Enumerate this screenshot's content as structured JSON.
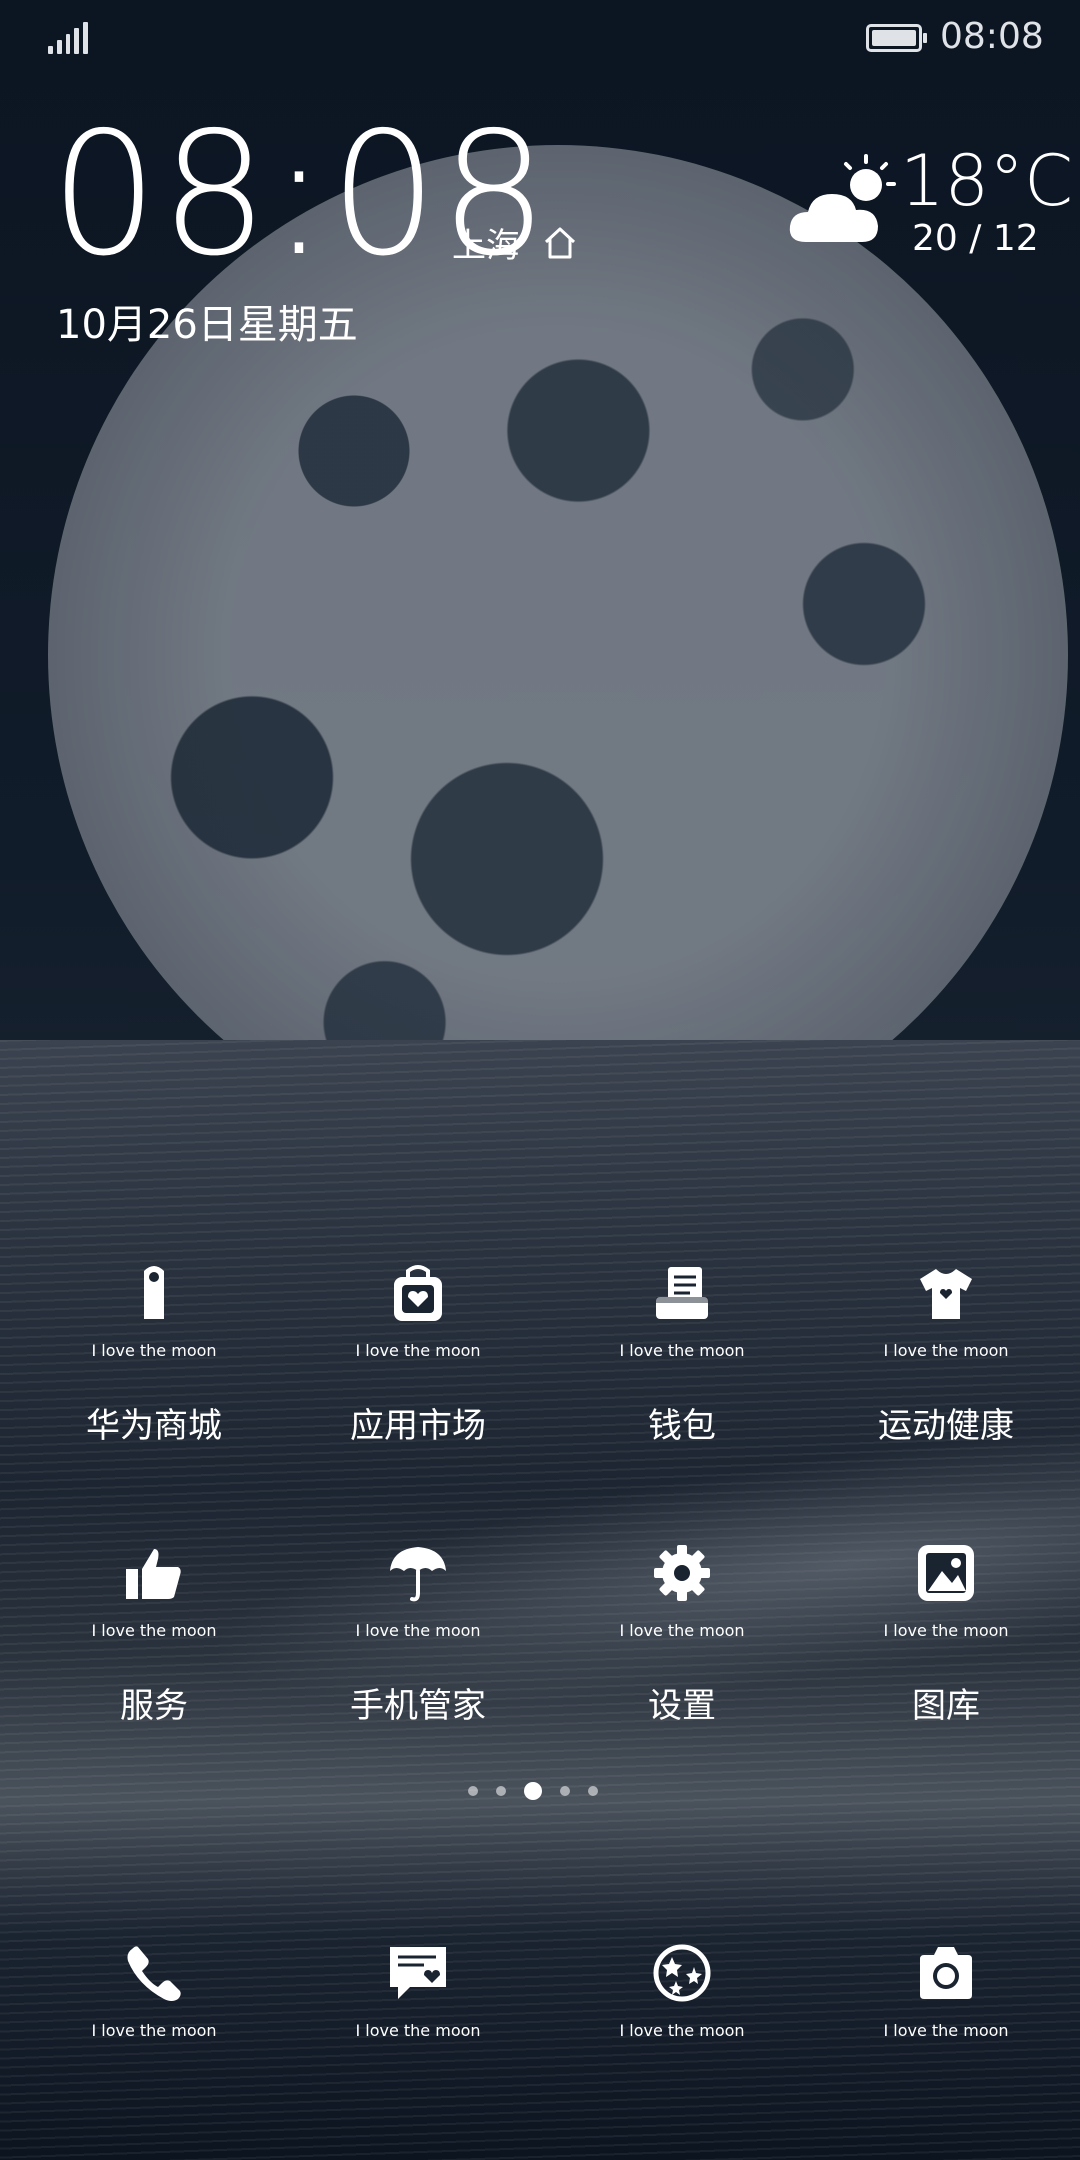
{
  "status_bar": {
    "time": "08:08",
    "icons": [
      "signal-icon",
      "battery-icon"
    ]
  },
  "clock_widget": {
    "time": "08:08",
    "city": "上海",
    "date": "10月26日星期五",
    "home_icon": "home-icon"
  },
  "weather": {
    "icon": "cloud-sun-icon",
    "temperature": "18°C",
    "range": "20 / 12"
  },
  "apps": [
    {
      "icon": "door-hanger-icon",
      "sub": "I love the moon",
      "label": "华为商城"
    },
    {
      "icon": "shopping-bag-heart-icon",
      "sub": "I love the moon",
      "label": "应用市场"
    },
    {
      "icon": "wallet-receipt-icon",
      "sub": "I love the moon",
      "label": "钱包"
    },
    {
      "icon": "tshirt-heart-icon",
      "sub": "I love the moon",
      "label": "运动健康"
    },
    {
      "icon": "thumbs-up-icon",
      "sub": "I love the moon",
      "label": "服务"
    },
    {
      "icon": "umbrella-icon",
      "sub": "I love the moon",
      "label": "手机管家"
    },
    {
      "icon": "gear-icon",
      "sub": "I love the moon",
      "label": "设置"
    },
    {
      "icon": "picture-icon",
      "sub": "I love the moon",
      "label": "图库"
    }
  ],
  "page_indicator": {
    "count": 5,
    "active_index": 2
  },
  "dock": [
    {
      "icon": "phone-icon",
      "sub": "I love the moon"
    },
    {
      "icon": "message-heart-icon",
      "sub": "I love the moon"
    },
    {
      "icon": "star-circle-icon",
      "sub": "I love the moon"
    },
    {
      "icon": "camera-icon",
      "sub": "I love the moon"
    }
  ]
}
